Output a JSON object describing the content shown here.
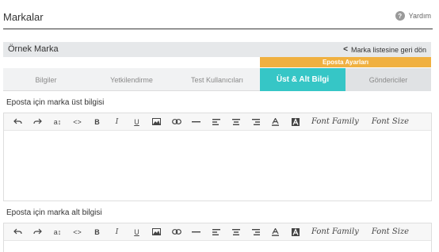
{
  "header": {
    "title": "Markalar",
    "help_label": "Yardım",
    "help_icon": "question-icon"
  },
  "brand": {
    "name": "Örnek Marka",
    "back_label": "Marka listesine geri dön"
  },
  "tab_group": {
    "label": "Eposta Ayarları"
  },
  "tabs": [
    {
      "label": "Bilgiler"
    },
    {
      "label": "Yetkilendirme"
    },
    {
      "label": "Test Kullanıcıları"
    },
    {
      "label": "Üst & Alt Bilgi"
    },
    {
      "label": "Göndericiler"
    }
  ],
  "header_editor": {
    "label": "Eposta için marka üst bilgisi"
  },
  "footer_editor": {
    "label": "Eposta için marka alt bilgisi"
  },
  "toolbar": {
    "superscript": "a↕",
    "code": "<>",
    "bold": "B",
    "italic": "I",
    "underline": "U",
    "font_family": "Font Family",
    "font_size": "Font Size"
  },
  "colors": {
    "accent_teal": "#36c6c6",
    "accent_orange": "#f0b040"
  }
}
